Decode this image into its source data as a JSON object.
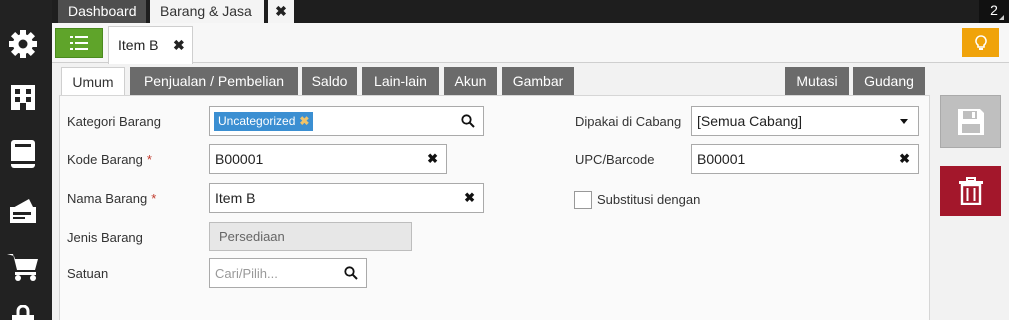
{
  "top_tabs": {
    "dashboard": "Dashboard",
    "barang_jasa": "Barang & Jasa",
    "close": "✖",
    "counter": "2"
  },
  "item_tab": {
    "label": "Item B",
    "close": "✖"
  },
  "sub_tabs": [
    "Umum",
    "Penjualan / Pembelian",
    "Saldo",
    "Lain-lain",
    "Akun",
    "Gambar",
    "Mutasi",
    "Gudang"
  ],
  "form": {
    "kategori": {
      "label": "Kategori Barang",
      "chip": "Uncategorized",
      "chip_close": "✖"
    },
    "kode": {
      "label": "Kode Barang",
      "value": "B00001",
      "required": "*"
    },
    "nama": {
      "label": "Nama Barang",
      "value": "Item B",
      "required": "*"
    },
    "jenis": {
      "label": "Jenis Barang",
      "value": "Persediaan"
    },
    "satuan": {
      "label": "Satuan",
      "placeholder": "Cari/Pilih..."
    },
    "cabang": {
      "label": "Dipakai di Cabang",
      "value": "[Semua Cabang]"
    },
    "upc": {
      "label": "UPC/Barcode",
      "value": "B00001"
    },
    "substitusi": {
      "label": "Substitusi dengan"
    },
    "clear_glyph": "✖"
  },
  "colors": {
    "sidebar": "#222222",
    "list_button": "#5fa42a",
    "bulb_button": "#f0a30a",
    "delete_button": "#a3172b",
    "chip": "#3b8fd2"
  },
  "icons": {
    "sidebar": [
      "gear-icon",
      "building-icon",
      "book-icon",
      "wallet-icon",
      "cart-icon",
      "bag-icon"
    ],
    "list": "list-icon",
    "bulb": "lightbulb-icon",
    "save": "floppy-icon",
    "delete": "trash-icon"
  }
}
